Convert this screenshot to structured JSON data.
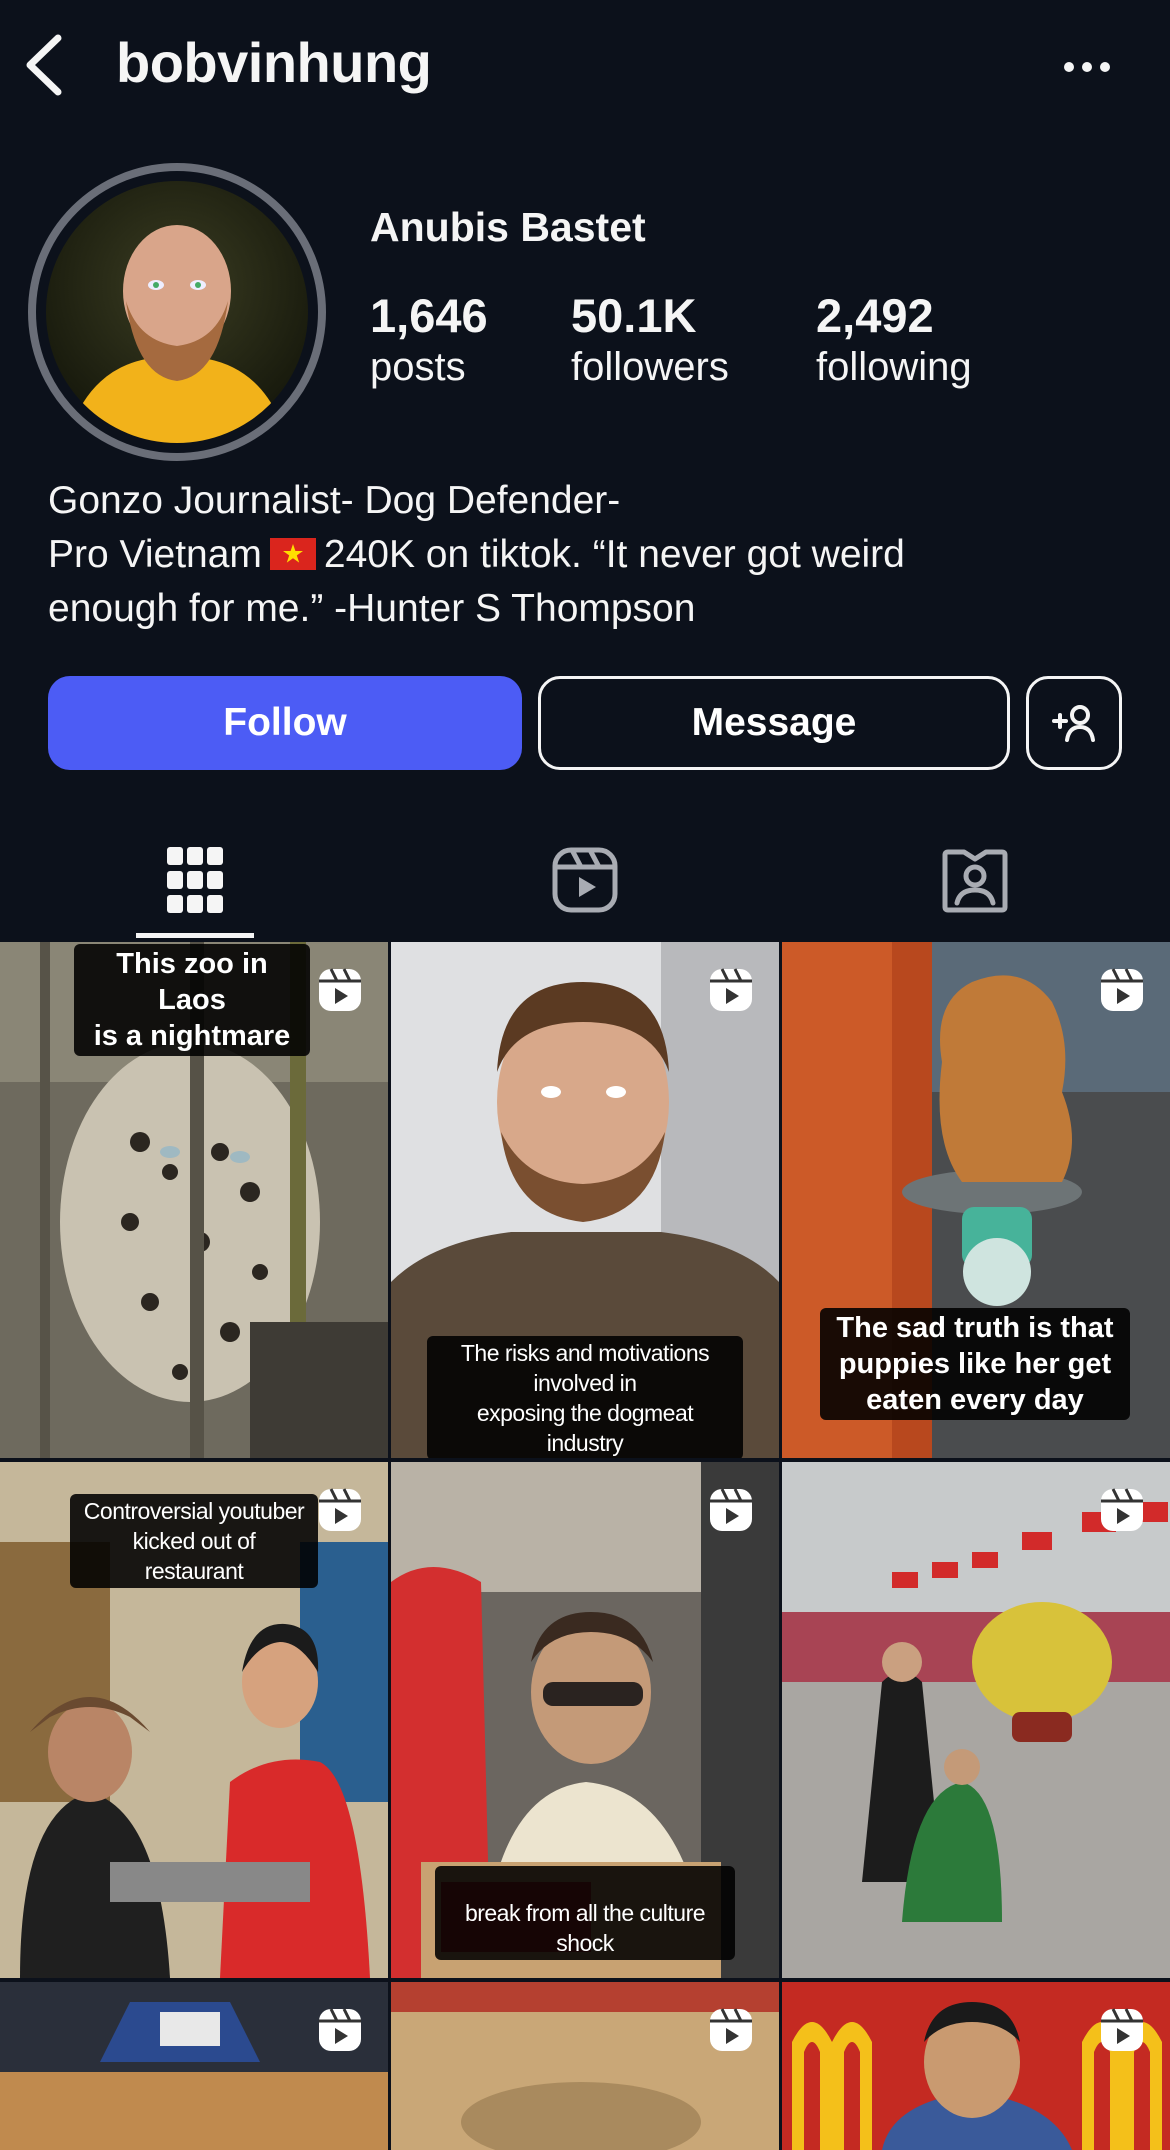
{
  "header": {
    "username": "bobvinhung"
  },
  "profile": {
    "display_name": "Anubis Bastet",
    "stats": [
      {
        "value": "1,646",
        "label": "posts"
      },
      {
        "value": "50.1K",
        "label": "followers"
      },
      {
        "value": "2,492",
        "label": "following"
      }
    ],
    "bio": {
      "line1": "Gonzo Journalist- Dog Defender-",
      "line2_pre": "Pro Vietnam",
      "line2_post": "240K on tiktok. “It never got weird",
      "line3": "enough for me.” -Hunter S Thompson"
    }
  },
  "actions": {
    "follow": "Follow",
    "message": "Message"
  },
  "tabs": [
    {
      "icon": "grid-icon",
      "active": true
    },
    {
      "icon": "reels-icon",
      "active": false
    },
    {
      "icon": "tagged-icon",
      "active": false
    }
  ],
  "posts": [
    {
      "caption": "This zoo in Laos\nis a nightmare",
      "type": "reel"
    },
    {
      "caption": "The risks and motivations involved in\nexposing the dogmeat industry",
      "type": "reel"
    },
    {
      "caption": "The sad truth is that\npuppies like her get\neaten every day",
      "type": "reel"
    },
    {
      "caption": "Controversial youtuber\nkicked out of restaurant",
      "type": "reel"
    },
    {
      "caption": "",
      "type": "reel"
    },
    {
      "caption": "",
      "type": "reel"
    },
    {
      "caption": "Me at the KFC in Saigon taking a\nbreak from all the culture shock",
      "type": "reel"
    },
    {
      "caption": "",
      "type": "reel"
    },
    {
      "caption": "",
      "type": "reel"
    }
  ],
  "colors": {
    "background": "#0c111b",
    "follow_button": "#4c5cf5",
    "text": "#f5f5f5"
  }
}
